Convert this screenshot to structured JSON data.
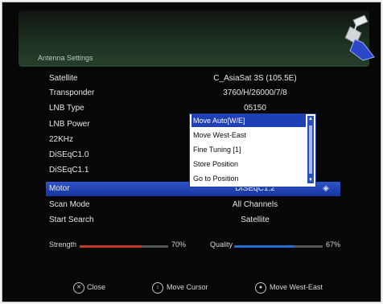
{
  "header": {
    "title": "Antenna Settings"
  },
  "settings": [
    {
      "name": "satellite",
      "label": "Satellite",
      "value": "C_AsiaSat 3S (105.5E)"
    },
    {
      "name": "transponder",
      "label": "Transponder",
      "value": "3760/H/26000/7/8"
    },
    {
      "name": "lnb-type",
      "label": "LNB Type",
      "value": "05150"
    },
    {
      "name": "lnb-power",
      "label": "LNB Power",
      "value": ""
    },
    {
      "name": "22khz",
      "label": "22KHz",
      "value": ""
    },
    {
      "name": "diseqc10",
      "label": "DiSEqC1.0",
      "value": ""
    },
    {
      "name": "diseqc11",
      "label": "DiSEqC1.1",
      "value": ""
    },
    {
      "name": "motor",
      "label": "Motor",
      "value": "DiSEqC1.2"
    },
    {
      "name": "scan-mode",
      "label": "Scan Mode",
      "value": "All Channels"
    },
    {
      "name": "start-search",
      "label": "Start Search",
      "value": "Satellite"
    }
  ],
  "motor_dropdown": {
    "items": [
      "Move Auto[W/E]",
      "Move West-East",
      "Fine Tuning [1]",
      "Store Position",
      "Go to Position"
    ],
    "selected_index": 0
  },
  "signal": {
    "strength_label": "Strength",
    "strength_value": "70%",
    "strength_level": 0.7,
    "strength_color": "#c0392b",
    "quality_label": "Quality",
    "quality_value": "67%",
    "quality_level": 0.67,
    "quality_color": "#1f6fd1"
  },
  "footer": {
    "close_label": "Close",
    "move_cursor_label": "Move Cursor",
    "move_west_east_label": "Move West-East"
  },
  "icons": {
    "header": "satellite-icon",
    "motor": "option-icon",
    "footer": [
      "exit-key-icon",
      "arrow-keys-icon",
      "ok-key-icon"
    ]
  },
  "colors": {
    "selection": "#1f3fb4",
    "background": "#070707"
  }
}
